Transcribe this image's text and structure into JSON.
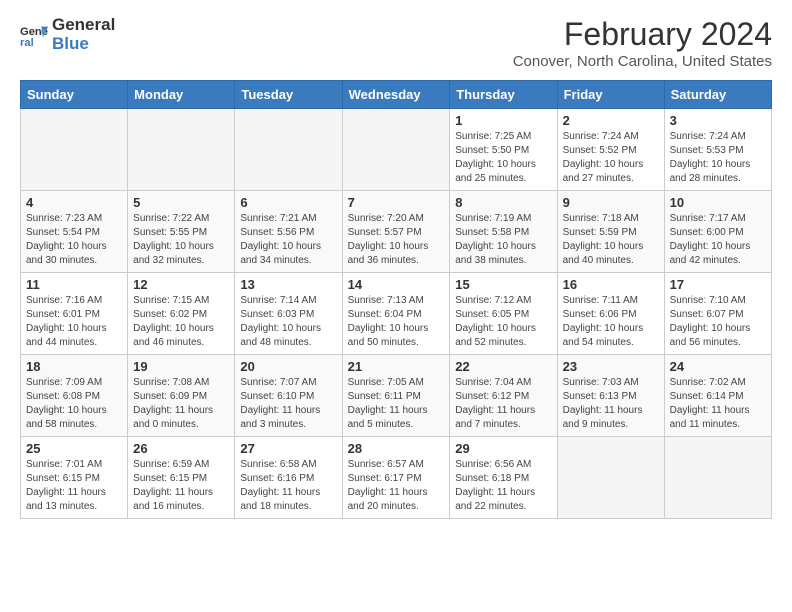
{
  "header": {
    "logo_line1": "General",
    "logo_line2": "Blue",
    "title": "February 2024",
    "subtitle": "Conover, North Carolina, United States"
  },
  "calendar": {
    "weekdays": [
      "Sunday",
      "Monday",
      "Tuesday",
      "Wednesday",
      "Thursday",
      "Friday",
      "Saturday"
    ],
    "weeks": [
      [
        {
          "day": "",
          "info": ""
        },
        {
          "day": "",
          "info": ""
        },
        {
          "day": "",
          "info": ""
        },
        {
          "day": "",
          "info": ""
        },
        {
          "day": "1",
          "info": "Sunrise: 7:25 AM\nSunset: 5:50 PM\nDaylight: 10 hours\nand 25 minutes."
        },
        {
          "day": "2",
          "info": "Sunrise: 7:24 AM\nSunset: 5:52 PM\nDaylight: 10 hours\nand 27 minutes."
        },
        {
          "day": "3",
          "info": "Sunrise: 7:24 AM\nSunset: 5:53 PM\nDaylight: 10 hours\nand 28 minutes."
        }
      ],
      [
        {
          "day": "4",
          "info": "Sunrise: 7:23 AM\nSunset: 5:54 PM\nDaylight: 10 hours\nand 30 minutes."
        },
        {
          "day": "5",
          "info": "Sunrise: 7:22 AM\nSunset: 5:55 PM\nDaylight: 10 hours\nand 32 minutes."
        },
        {
          "day": "6",
          "info": "Sunrise: 7:21 AM\nSunset: 5:56 PM\nDaylight: 10 hours\nand 34 minutes."
        },
        {
          "day": "7",
          "info": "Sunrise: 7:20 AM\nSunset: 5:57 PM\nDaylight: 10 hours\nand 36 minutes."
        },
        {
          "day": "8",
          "info": "Sunrise: 7:19 AM\nSunset: 5:58 PM\nDaylight: 10 hours\nand 38 minutes."
        },
        {
          "day": "9",
          "info": "Sunrise: 7:18 AM\nSunset: 5:59 PM\nDaylight: 10 hours\nand 40 minutes."
        },
        {
          "day": "10",
          "info": "Sunrise: 7:17 AM\nSunset: 6:00 PM\nDaylight: 10 hours\nand 42 minutes."
        }
      ],
      [
        {
          "day": "11",
          "info": "Sunrise: 7:16 AM\nSunset: 6:01 PM\nDaylight: 10 hours\nand 44 minutes."
        },
        {
          "day": "12",
          "info": "Sunrise: 7:15 AM\nSunset: 6:02 PM\nDaylight: 10 hours\nand 46 minutes."
        },
        {
          "day": "13",
          "info": "Sunrise: 7:14 AM\nSunset: 6:03 PM\nDaylight: 10 hours\nand 48 minutes."
        },
        {
          "day": "14",
          "info": "Sunrise: 7:13 AM\nSunset: 6:04 PM\nDaylight: 10 hours\nand 50 minutes."
        },
        {
          "day": "15",
          "info": "Sunrise: 7:12 AM\nSunset: 6:05 PM\nDaylight: 10 hours\nand 52 minutes."
        },
        {
          "day": "16",
          "info": "Sunrise: 7:11 AM\nSunset: 6:06 PM\nDaylight: 10 hours\nand 54 minutes."
        },
        {
          "day": "17",
          "info": "Sunrise: 7:10 AM\nSunset: 6:07 PM\nDaylight: 10 hours\nand 56 minutes."
        }
      ],
      [
        {
          "day": "18",
          "info": "Sunrise: 7:09 AM\nSunset: 6:08 PM\nDaylight: 10 hours\nand 58 minutes."
        },
        {
          "day": "19",
          "info": "Sunrise: 7:08 AM\nSunset: 6:09 PM\nDaylight: 11 hours\nand 0 minutes."
        },
        {
          "day": "20",
          "info": "Sunrise: 7:07 AM\nSunset: 6:10 PM\nDaylight: 11 hours\nand 3 minutes."
        },
        {
          "day": "21",
          "info": "Sunrise: 7:05 AM\nSunset: 6:11 PM\nDaylight: 11 hours\nand 5 minutes."
        },
        {
          "day": "22",
          "info": "Sunrise: 7:04 AM\nSunset: 6:12 PM\nDaylight: 11 hours\nand 7 minutes."
        },
        {
          "day": "23",
          "info": "Sunrise: 7:03 AM\nSunset: 6:13 PM\nDaylight: 11 hours\nand 9 minutes."
        },
        {
          "day": "24",
          "info": "Sunrise: 7:02 AM\nSunset: 6:14 PM\nDaylight: 11 hours\nand 11 minutes."
        }
      ],
      [
        {
          "day": "25",
          "info": "Sunrise: 7:01 AM\nSunset: 6:15 PM\nDaylight: 11 hours\nand 13 minutes."
        },
        {
          "day": "26",
          "info": "Sunrise: 6:59 AM\nSunset: 6:15 PM\nDaylight: 11 hours\nand 16 minutes."
        },
        {
          "day": "27",
          "info": "Sunrise: 6:58 AM\nSunset: 6:16 PM\nDaylight: 11 hours\nand 18 minutes."
        },
        {
          "day": "28",
          "info": "Sunrise: 6:57 AM\nSunset: 6:17 PM\nDaylight: 11 hours\nand 20 minutes."
        },
        {
          "day": "29",
          "info": "Sunrise: 6:56 AM\nSunset: 6:18 PM\nDaylight: 11 hours\nand 22 minutes."
        },
        {
          "day": "",
          "info": ""
        },
        {
          "day": "",
          "info": ""
        }
      ]
    ]
  }
}
